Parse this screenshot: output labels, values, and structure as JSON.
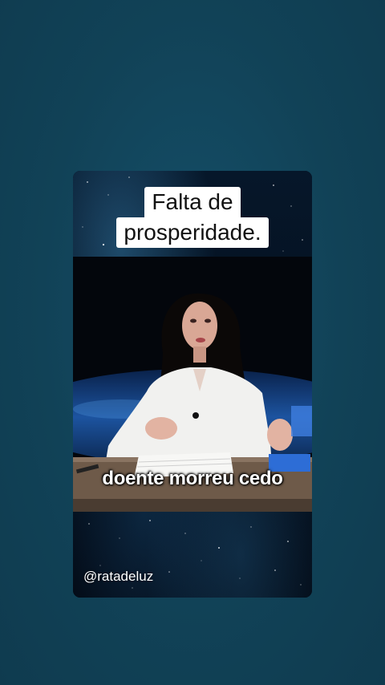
{
  "video": {
    "caption_line_1": "Falta de",
    "caption_line_2": "prosperidade.",
    "subtitle": "doente morreu cedo",
    "creator_handle": "@ratadeluz"
  },
  "colors": {
    "background": "#114257",
    "caption_bg": "#ffffff",
    "caption_text": "#111111",
    "subtitle_text": "#ffffff"
  }
}
